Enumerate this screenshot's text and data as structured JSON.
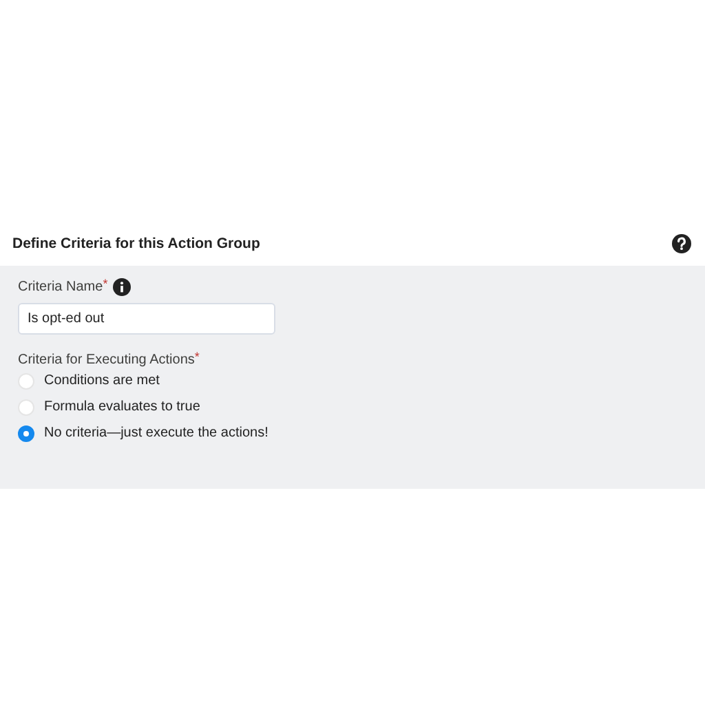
{
  "header": {
    "title": "Define Criteria for this Action Group"
  },
  "name_field": {
    "label": "Criteria Name",
    "required_mark": "*",
    "value": "Is opt-ed out"
  },
  "criteria": {
    "label": "Criteria for Executing Actions",
    "required_mark": "*",
    "options": [
      {
        "label": "Conditions are met",
        "selected": false
      },
      {
        "label": "Formula evaluates to true",
        "selected": false
      },
      {
        "label": "No criteria—just execute the actions!",
        "selected": true
      }
    ]
  }
}
